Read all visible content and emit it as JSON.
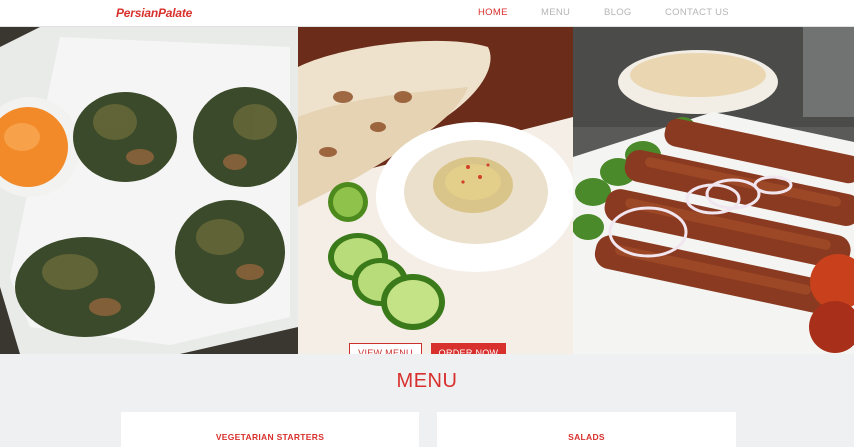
{
  "colors": {
    "brand": "#d8302c",
    "nav_inactive": "#b5b5b5",
    "page_bg": "#eef0f2"
  },
  "nav": {
    "logo": "PersianPalate",
    "links": [
      {
        "label": "HOME",
        "active": true
      },
      {
        "label": "MENU",
        "active": false
      },
      {
        "label": "BLOG",
        "active": false
      },
      {
        "label": "CONTACT US",
        "active": false
      }
    ]
  },
  "hero": {
    "images": [
      "vegetable-fritters-photo",
      "hummus-and-bread-photo",
      "kebab-platter-photo"
    ],
    "view_menu_label": "VIEW MENU",
    "order_now_label": "ORDER NOW"
  },
  "menu_section": {
    "title": "MENU",
    "categories": [
      {
        "title": "VEGETARIAN STARTERS"
      },
      {
        "title": "SALADS"
      }
    ]
  }
}
